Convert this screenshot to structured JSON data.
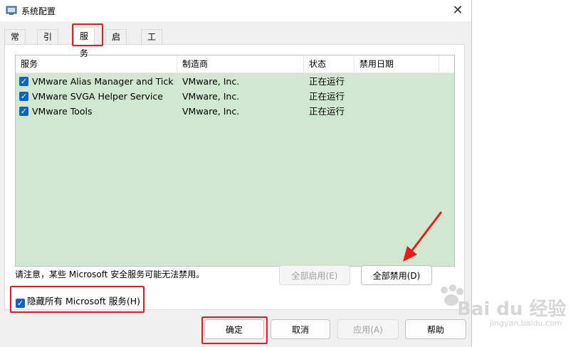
{
  "window": {
    "title": "系统配置",
    "close_glyph": "✕"
  },
  "tabs": [
    {
      "label": "常规",
      "active": false
    },
    {
      "label": "引导",
      "active": false
    },
    {
      "label": "服务",
      "active": true
    },
    {
      "label": "启动",
      "active": false
    },
    {
      "label": "工具",
      "active": false
    }
  ],
  "services_table": {
    "columns": [
      "服务",
      "制造商",
      "状态",
      "禁用日期"
    ],
    "rows": [
      {
        "checked": true,
        "service": "VMware Alias Manager and Tick...",
        "vendor": "VMware, Inc.",
        "status": "正在运行",
        "disabled_date": ""
      },
      {
        "checked": true,
        "service": "VMware SVGA Helper Service",
        "vendor": "VMware, Inc.",
        "status": "正在运行",
        "disabled_date": ""
      },
      {
        "checked": true,
        "service": "VMware Tools",
        "vendor": "VMware, Inc.",
        "status": "正在运行",
        "disabled_date": ""
      }
    ]
  },
  "note": "请注意，某些 Microsoft 安全服务可能无法禁用。",
  "buttons": {
    "enable_all": "全部启用(E)",
    "disable_all": "全部禁用(D)",
    "ok": "确定",
    "cancel": "取消",
    "apply": "应用(A)",
    "help": "帮助"
  },
  "hide_microsoft": {
    "label": "隐藏所有 Microsoft 服务(H)",
    "checked": true
  },
  "colors": {
    "annotation_red": "#e81c1c",
    "list_bg": "#cfe8cf",
    "checkbox_blue": "#0f62c6"
  },
  "watermark": {
    "brand": "Bai du 经验",
    "url": "jingyan.baidu.com"
  }
}
